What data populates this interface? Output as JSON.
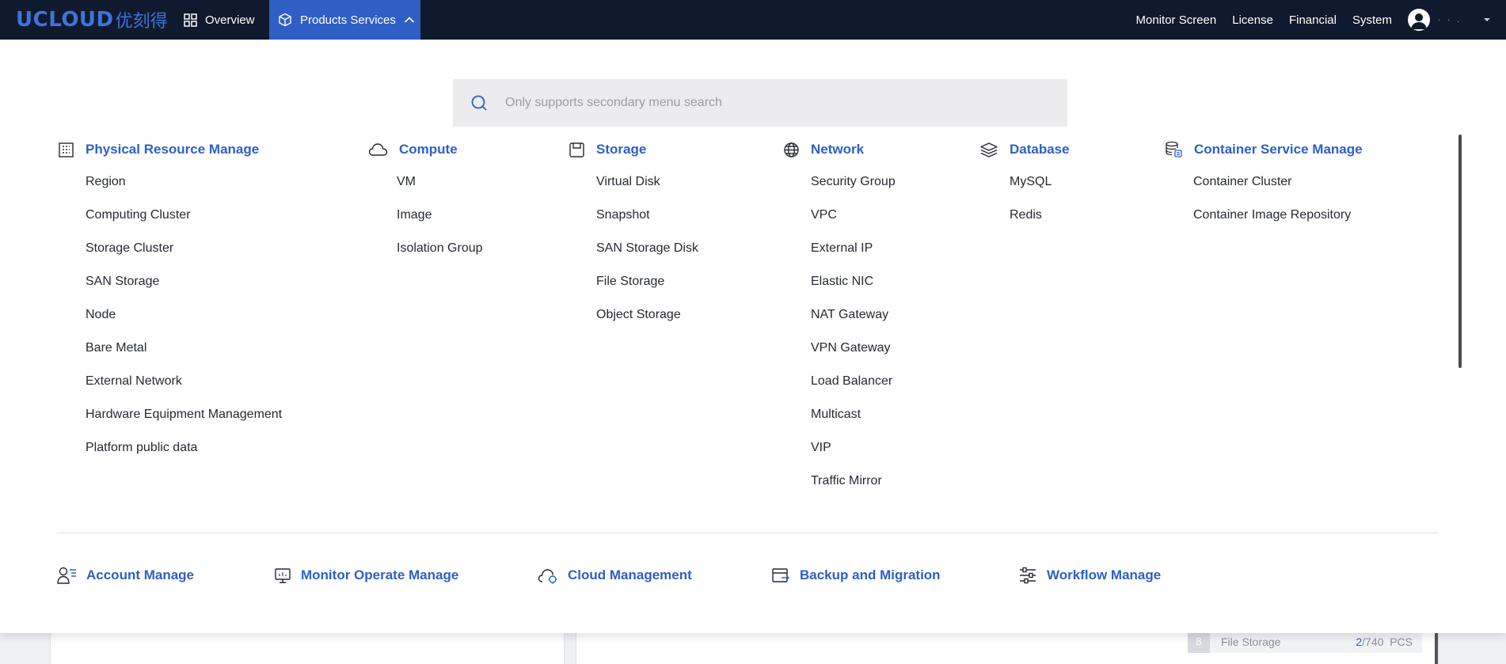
{
  "logo": {
    "text": "UCLOUD",
    "cn": "优刻得"
  },
  "topnav": {
    "overview": "Overview",
    "products": "Products Services",
    "monitor": "Monitor Screen",
    "license": "License",
    "financial": "Financial",
    "system": "System",
    "user": "· · ."
  },
  "search": {
    "placeholder": "Only supports secondary menu search",
    "value": ""
  },
  "categories": [
    {
      "title": "Physical Resource Manage",
      "icon": "building-icon",
      "items": [
        "Region",
        "Computing Cluster",
        "Storage Cluster",
        "SAN Storage",
        "Node",
        "Bare Metal",
        "External Network",
        "Hardware Equipment Management",
        "Platform public data"
      ]
    },
    {
      "title": "Compute",
      "icon": "cloud-icon",
      "items": [
        "VM",
        "Image",
        "Isolation Group"
      ]
    },
    {
      "title": "Storage",
      "icon": "storage-box-icon",
      "items": [
        "Virtual Disk",
        "Snapshot",
        "SAN Storage Disk",
        "File Storage",
        "Object Storage"
      ]
    },
    {
      "title": "Network",
      "icon": "globe-icon",
      "items": [
        "Security Group",
        "VPC",
        "External IP",
        "Elastic NIC",
        "NAT Gateway",
        "VPN Gateway",
        "Load Balancer",
        "Multicast",
        "VIP",
        "Traffic Mirror"
      ]
    },
    {
      "title": "Database",
      "icon": "layers-icon",
      "items": [
        "MySQL",
        "Redis"
      ]
    },
    {
      "title": "Container Service Manage",
      "icon": "database-stack-icon",
      "items": [
        "Container Cluster",
        "Container Image Repository"
      ]
    }
  ],
  "bottom_categories": [
    {
      "title": "Account Manage",
      "icon": "user-list-icon"
    },
    {
      "title": "Monitor Operate Manage",
      "icon": "monitor-icon"
    },
    {
      "title": "Cloud Management",
      "icon": "cloud-settings-icon"
    },
    {
      "title": "Backup and Migration",
      "icon": "backup-icon"
    },
    {
      "title": "Workflow Manage",
      "icon": "sliders-icon"
    }
  ],
  "background_row": {
    "index": "8",
    "label": "File Storage",
    "used": "2",
    "total": "/740",
    "unit": "PCS"
  },
  "colors": {
    "topbar": "#101a2e",
    "accent": "#2f5fc4",
    "text": "#262a33"
  }
}
